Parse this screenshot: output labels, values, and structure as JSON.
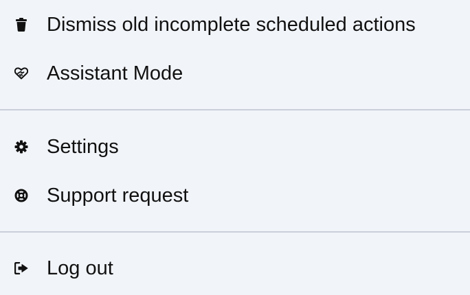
{
  "menu": {
    "items": [
      {
        "id": "dismiss",
        "label": "Dismiss old incomplete scheduled actions",
        "icon": "trash-icon"
      },
      {
        "id": "assistant",
        "label": "Assistant Mode",
        "icon": "handshake-heart-icon"
      },
      {
        "id": "settings",
        "label": "Settings",
        "icon": "gear-icon"
      },
      {
        "id": "support",
        "label": "Support request",
        "icon": "life-ring-icon"
      },
      {
        "id": "logout",
        "label": "Log out",
        "icon": "sign-out-icon"
      }
    ]
  },
  "colors": {
    "background": "#f1f4f9",
    "text": "#111111",
    "divider": "#c9ced9"
  }
}
